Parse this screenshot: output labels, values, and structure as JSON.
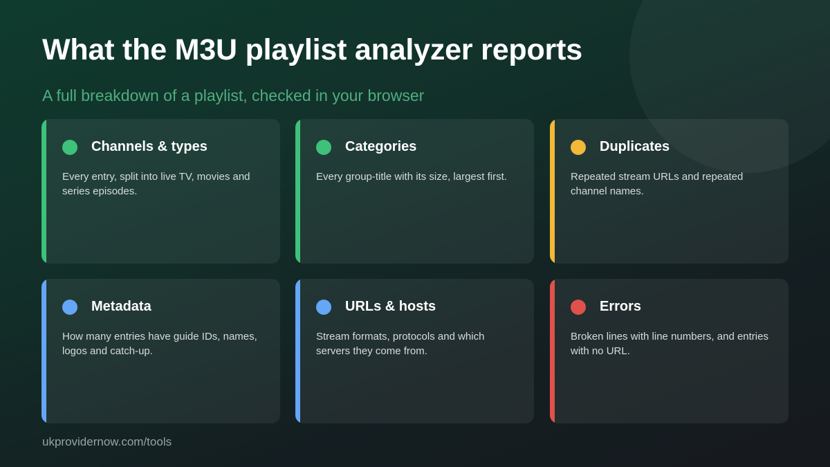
{
  "title": "What the M3U playlist analyzer reports",
  "subtitle": "A full breakdown of a playlist, checked in your browser",
  "colors": {
    "green": "#3ec17b",
    "yellow": "#f2b938",
    "blue": "#65a6f6",
    "red": "#e0514b",
    "subtitle": "#4fae7e"
  },
  "cards": [
    {
      "title": "Channels & types",
      "description": "Every entry, split into live TV, movies and series episodes.",
      "color": "#3ec17b"
    },
    {
      "title": "Categories",
      "description": "Every group-title with its size, largest first.",
      "color": "#3ec17b"
    },
    {
      "title": "Duplicates",
      "description": "Repeated stream URLs and repeated channel names.",
      "color": "#f2b938"
    },
    {
      "title": "Metadata",
      "description": "How many entries have guide IDs, names, logos and catch-up.",
      "color": "#65a6f6"
    },
    {
      "title": "URLs & hosts",
      "description": "Stream formats, protocols and which servers they come from.",
      "color": "#65a6f6"
    },
    {
      "title": "Errors",
      "description": "Broken lines with line numbers, and entries with no URL.",
      "color": "#e0514b"
    }
  ],
  "footer": "ukprovidernow.com/tools"
}
